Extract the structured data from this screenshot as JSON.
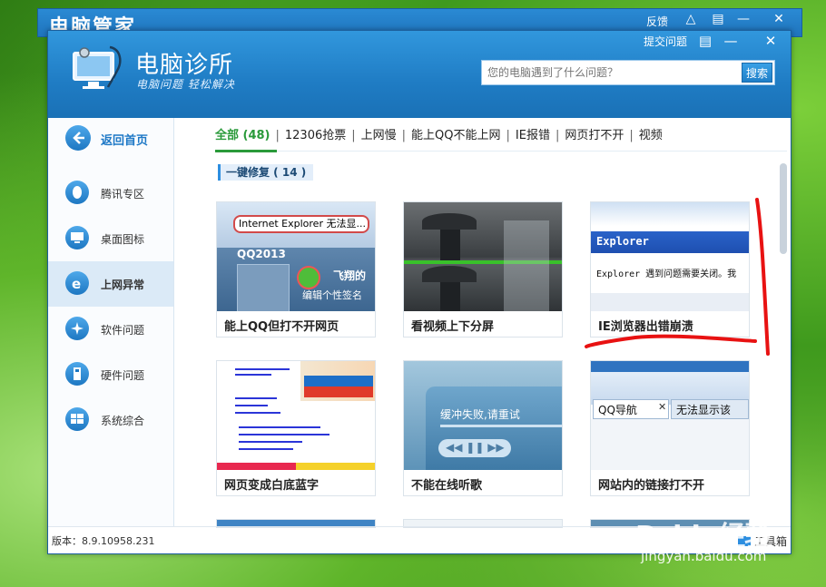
{
  "background_window": {
    "title": "电脑管家",
    "feedback": "反馈",
    "shirt_icon": "tshirt-icon",
    "menu_icon": "menu-icon"
  },
  "window": {
    "app_name": "电脑诊所",
    "slogan": "电脑问题 轻松解决",
    "submit_issue": "提交问题",
    "search": {
      "placeholder": "您的电脑遇到了什么问题？",
      "button": "搜索"
    },
    "version": "版本：8.9.10958.231",
    "toolbox": "工具箱"
  },
  "sidebar": {
    "back": "返回首页",
    "items": [
      {
        "label": "腾讯专区",
        "icon": "qq-penguin-icon"
      },
      {
        "label": "桌面图标",
        "icon": "monitor-icon"
      },
      {
        "label": "上网异常",
        "icon": "ie-icon",
        "active": true
      },
      {
        "label": "软件问题",
        "icon": "software-icon"
      },
      {
        "label": "硬件问题",
        "icon": "hardware-icon"
      },
      {
        "label": "系统综合",
        "icon": "windows-icon"
      }
    ]
  },
  "tabs": [
    "全部 (48)",
    "12306抢票",
    "上网慢",
    "能上QQ不能上网",
    "IE报错",
    "网页打不开",
    "视频"
  ],
  "section_title": "一键修复 ( 14 )",
  "cards": [
    {
      "caption": "能上QQ但打不开网页",
      "thumb_text": [
        "Internet Explorer 无法显...",
        "QQ2013",
        "飞翔的",
        "编辑个性签名"
      ]
    },
    {
      "caption": "看视频上下分屏"
    },
    {
      "caption": "IE浏览器出错崩溃",
      "thumb_text": [
        "Explorer",
        "Explorer 遇到问题需要关闭。我"
      ]
    },
    {
      "caption": "网页变成白底蓝字"
    },
    {
      "caption": "不能在线听歌",
      "thumb_text": [
        "缓冲失败,请重试"
      ]
    },
    {
      "caption": "网站内的链接打不开",
      "thumb_text": [
        "QQ导航",
        "无法显示该"
      ]
    }
  ],
  "watermark": {
    "brand": "Baidu经验",
    "url": "jingyan.baidu.com"
  },
  "colors": {
    "accent": "#1f7cc4",
    "active_tab": "#2a9a3a",
    "annotation": "#e81212"
  }
}
